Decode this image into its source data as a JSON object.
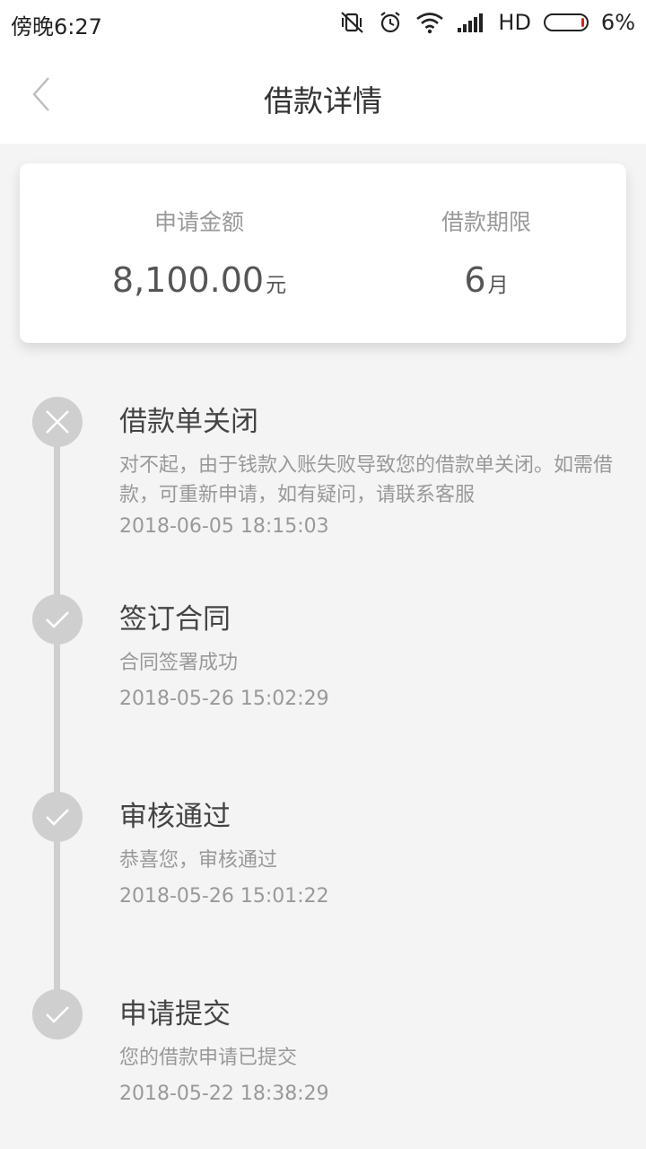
{
  "status_bar": {
    "time": "傍晚6:27",
    "network": "HD",
    "battery": "6%",
    "battery_level": 0.06,
    "icons": [
      "vibrate-off-icon",
      "alarm-icon",
      "wifi-icon",
      "signal-icon",
      "battery-icon"
    ]
  },
  "nav": {
    "title": "借款详情",
    "back_icon": "chevron-left-icon"
  },
  "summary": {
    "amount_label": "申请金额",
    "amount_value": "8,100.00",
    "amount_unit": "元",
    "term_label": "借款期限",
    "term_value": "6",
    "term_unit": "月"
  },
  "timeline": [
    {
      "title": "借款单关闭",
      "description": "对不起，由于钱款入账失败导致您的借款单关闭。如需借款，可重新申请，如有疑问，请联系客服",
      "time": "2018-06-05 18:15:03",
      "icon": "close-icon"
    },
    {
      "title": "签订合同",
      "description": "合同签署成功",
      "time": "2018-05-26 15:02:29",
      "icon": "check-icon"
    },
    {
      "title": "审核通过",
      "description": "恭喜您，审核通过",
      "time": "2018-05-26 15:01:22",
      "icon": "check-icon"
    },
    {
      "title": "申请提交",
      "description": "您的借款申请已提交",
      "time": "2018-05-22 18:38:29",
      "icon": "check-icon"
    }
  ],
  "colors": {
    "background": "#f4f4f4",
    "card": "#ffffff",
    "timeline": "#cfcfcf",
    "battery_low": "#e02020"
  }
}
